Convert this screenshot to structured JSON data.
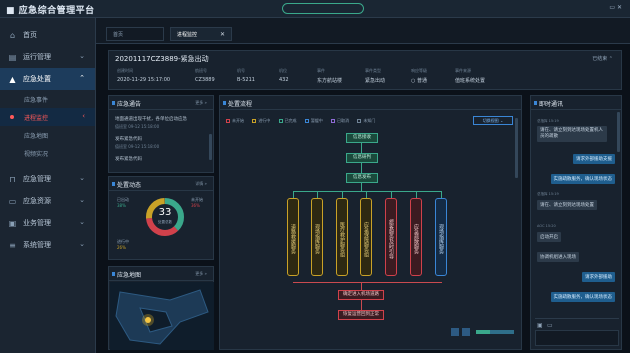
{
  "header": {
    "brand": "■ 应急综合管理平台",
    "center_pill": "",
    "user": "▭ ✕"
  },
  "sidebar": {
    "items": [
      {
        "icon": "⌂",
        "label": "首页",
        "chev": ""
      },
      {
        "icon": "▤",
        "label": "运行管理",
        "chev": "⌄"
      },
      {
        "icon": "▲",
        "label": "应急处置",
        "chev": "⌃"
      },
      {
        "icon": "⊓",
        "label": "应急管理",
        "chev": "⌄"
      },
      {
        "icon": "▭",
        "label": "应急资源",
        "chev": "⌄"
      },
      {
        "icon": "▣",
        "label": "业务管理",
        "chev": "⌄"
      },
      {
        "icon": "≡",
        "label": "系统管理",
        "chev": "⌄"
      }
    ],
    "subitems": [
      "应急事件",
      "进程监控",
      "应急地图",
      "视频实况"
    ],
    "sub_chev": "‹"
  },
  "tabs": {
    "tab1": "首页",
    "tab2": "进程监控",
    "close": "✕"
  },
  "event": {
    "title": "20201117CZ3889-紧急出动",
    "more": "已结束 ⌃",
    "fields": [
      {
        "label": "创建时间",
        "value": "2020-11-29 15:17:00"
      },
      {
        "label": "航班号",
        "value": "CZ3889"
      },
      {
        "label": "机号",
        "value": "B-5211"
      },
      {
        "label": "机位",
        "value": "432"
      },
      {
        "label": "事件",
        "value": "东方航站楼"
      },
      {
        "label": "事件类型",
        "value": "紧急出动"
      },
      {
        "label": "响应等级",
        "value": "○ 普通"
      },
      {
        "label": "事件来源",
        "value": "值班系统处置"
      }
    ]
  },
  "notice": {
    "title": "应急通告",
    "more": "更多 »",
    "items": [
      {
        "text": "地面通道出现干扰，各单位启动应急",
        "time": "值班室 09-12 15:18:00"
      },
      {
        "text": "发布紧急代码",
        "time": "值班室 09-12 15:18:00"
      },
      {
        "text": "发布紧急代码",
        "time": ""
      }
    ]
  },
  "dispatch": {
    "title": "处置动态",
    "more": "详情 »",
    "center_value": "33",
    "center_label": "处置总数",
    "labels": [
      {
        "name": "已出动",
        "value": "38%"
      },
      {
        "name": "未开始",
        "value": "36%"
      },
      {
        "name": "进行中",
        "value": "26%"
      }
    ]
  },
  "map": {
    "title": "应急地图",
    "more": "更多 »"
  },
  "flow": {
    "title": "处置流程",
    "legend": [
      {
        "label": "未开始",
        "color": "#d0414b"
      },
      {
        "label": "进行中",
        "color": "#c9a227"
      },
      {
        "label": "已完成",
        "color": "#3aa88b"
      },
      {
        "label": "暂缓中",
        "color": "#3a86d6"
      },
      {
        "label": "已取消",
        "color": "#8e6bd6"
      },
      {
        "label": "未知门",
        "color": "#6f8295"
      }
    ],
    "select": "切换视图 ⌄",
    "top_nodes": [
      "信息接收",
      "信息研判",
      "信息发布"
    ],
    "columns": [
      {
        "label": "道路救援服务",
        "color": "#c9a227"
      },
      {
        "label": "现场指挥服务",
        "color": "#c9a227"
      },
      {
        "label": "医疗救护服务组",
        "color": "#c9a227"
      },
      {
        "label": "应急保障服务组",
        "color": "#c9a227"
      },
      {
        "label": "旅客服务及时引导",
        "color": "#d0414b"
      },
      {
        "label": "应急疏散服务",
        "color": "#d0414b"
      },
      {
        "label": "现场指挥服务",
        "color": "#3a86d6"
      }
    ],
    "bottom_nodes": [
      "确定进入机场道路",
      "恢复运营回到正常"
    ]
  },
  "chatpanel": {
    "title": "即时通讯",
    "messages": [
      {
        "side": "l",
        "meta": "总指挥 15:19",
        "text": "请在、请立刻到达现场处置机人员的疏散"
      },
      {
        "side": "r",
        "meta": "",
        "text": "请求外部援助支援"
      },
      {
        "side": "r",
        "meta": "",
        "text": "实施疏散服务，确认现场状态"
      },
      {
        "side": "l",
        "meta": "总指挥 15:19",
        "text": "请在、请立刻到达现场处置"
      },
      {
        "side": "l",
        "meta": "AOC 15:20",
        "text": "启动开启"
      },
      {
        "side": "l",
        "meta": "",
        "text": "协调机组进入现场"
      },
      {
        "side": "r",
        "meta": "",
        "text": "请求外部援助"
      },
      {
        "side": "r",
        "meta": "",
        "text": "实施疏散服务，确认现场状态"
      }
    ]
  }
}
